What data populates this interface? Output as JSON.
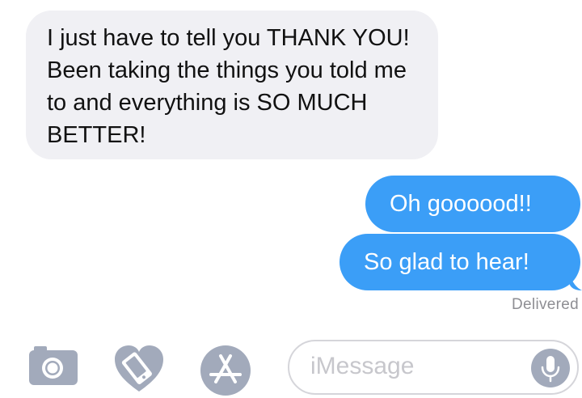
{
  "conversation": {
    "messages": [
      {
        "direction": "incoming",
        "text": "I just have to tell you THANK YOU! Been taking the things you told me to and everything is SO MUCH BETTER!"
      },
      {
        "direction": "outgoing",
        "text": "Oh goooood!!"
      },
      {
        "direction": "outgoing",
        "text": "So glad to hear!"
      }
    ],
    "status": "Delivered"
  },
  "composer": {
    "placeholder": "iMessage",
    "icons": [
      "camera-icon",
      "digital-touch-heart-icon",
      "app-store-icon",
      "microphone-icon"
    ]
  },
  "colors": {
    "incoming_bubble": "#f0f0f4",
    "outgoing_bubble": "#3b9ef7",
    "icon_gray": "#a2aabb",
    "status_text": "#8e8e93"
  }
}
